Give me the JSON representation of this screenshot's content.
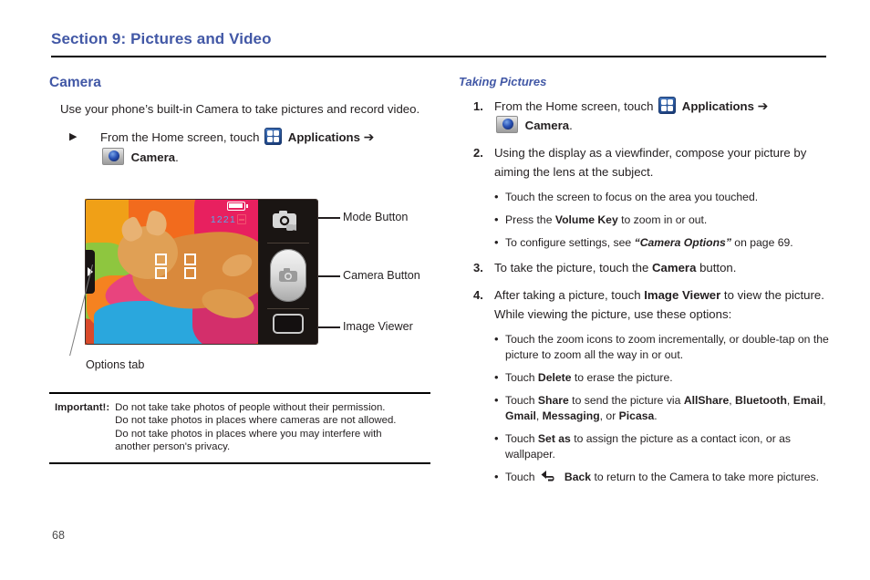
{
  "document": {
    "section_title": "Section 9: Pictures and Video",
    "page_number": "68"
  },
  "left_column": {
    "heading": "Camera",
    "intro": "Use your phone’s built-in Camera to take pictures and record video.",
    "arrow_step": {
      "marker": "▶",
      "text_before": "From the Home screen, touch",
      "apps_label": "Applications",
      "arrow": "➔",
      "camera_label": "Camera",
      "period": "."
    },
    "figure": {
      "status_count": "1221",
      "callouts": [
        {
          "name": "mode-button",
          "label": "Mode Button"
        },
        {
          "name": "camera-button",
          "label": "Camera Button"
        },
        {
          "name": "image-viewer",
          "label": "Image Viewer"
        },
        {
          "name": "options-tab",
          "label": "Options tab"
        }
      ]
    },
    "important_note": {
      "label": "Important!:",
      "lines": [
        "Do not take take photos of people without their permission.",
        "Do not take photos in places where cameras are not allowed.",
        "Do not take photos in places where you may interfere with",
        "another person's privacy."
      ]
    }
  },
  "right_column": {
    "heading": "Taking Pictures",
    "steps": [
      {
        "num": "1.",
        "kind": "icons",
        "text_before": "From the Home screen, touch",
        "apps_label": "Applications",
        "arrow": "➔",
        "camera_label": "Camera",
        "period": "."
      },
      {
        "num": "2.",
        "kind": "plain",
        "text": "Using the display as a viewfinder, compose your picture by aiming the lens at the subject.",
        "bullets": [
          {
            "id": "focus",
            "parts": [
              {
                "t": "Touch the screen to focus on the area you touched.",
                "s": "normal"
              }
            ]
          },
          {
            "id": "volume",
            "parts": [
              {
                "t": "Press the ",
                "s": "normal"
              },
              {
                "t": "Volume Key",
                "s": "bold"
              },
              {
                "t": " to zoom in or out.",
                "s": "normal"
              }
            ]
          },
          {
            "id": "settings",
            "parts": [
              {
                "t": "To configure settings, see ",
                "s": "normal"
              },
              {
                "t": "“Camera Options”",
                "s": "bolditalic"
              },
              {
                "t": " on page 69.",
                "s": "normal"
              }
            ]
          }
        ]
      },
      {
        "num": "3.",
        "kind": "rich",
        "parts": [
          {
            "t": "To take the picture, touch the ",
            "s": "normal"
          },
          {
            "t": "Camera",
            "s": "bold"
          },
          {
            "t": " button.",
            "s": "normal"
          }
        ],
        "bullets": []
      },
      {
        "num": "4.",
        "kind": "rich",
        "parts": [
          {
            "t": "After taking a picture, touch ",
            "s": "normal"
          },
          {
            "t": "Image Viewer",
            "s": "bold"
          },
          {
            "t": " to view the picture. While viewing the picture, use these options:",
            "s": "normal"
          }
        ],
        "bullets": [
          {
            "id": "zoom",
            "parts": [
              {
                "t": "Touch the zoom icons to zoom incrementally, or double-tap on the picture to zoom all the way in or out.",
                "s": "normal"
              }
            ]
          },
          {
            "id": "delete",
            "parts": [
              {
                "t": "Touch ",
                "s": "normal"
              },
              {
                "t": "Delete",
                "s": "bold"
              },
              {
                "t": "  to erase the picture.",
                "s": "normal"
              }
            ]
          },
          {
            "id": "share",
            "parts": [
              {
                "t": "Touch ",
                "s": "normal"
              },
              {
                "t": "Share",
                "s": "bold"
              },
              {
                "t": " to send the picture via ",
                "s": "normal"
              },
              {
                "t": "AllShare",
                "s": "bold"
              },
              {
                "t": ", ",
                "s": "normal"
              },
              {
                "t": "Bluetooth",
                "s": "bold"
              },
              {
                "t": ", ",
                "s": "normal"
              },
              {
                "t": "Email",
                "s": "bold"
              },
              {
                "t": ", ",
                "s": "normal"
              },
              {
                "t": "Gmail",
                "s": "bold"
              },
              {
                "t": ", ",
                "s": "normal"
              },
              {
                "t": "Messaging",
                "s": "bold"
              },
              {
                "t": ", or ",
                "s": "normal"
              },
              {
                "t": "Picasa",
                "s": "bold"
              },
              {
                "t": ".",
                "s": "normal"
              }
            ]
          },
          {
            "id": "setas",
            "parts": [
              {
                "t": "Touch ",
                "s": "normal"
              },
              {
                "t": "Set as",
                "s": "bold"
              },
              {
                "t": "  to assign the picture as a contact icon, or as wallpaper.",
                "s": "normal"
              }
            ]
          },
          {
            "id": "back",
            "icon": "back-arrow-icon",
            "parts": [
              {
                "t": "Touch ",
                "s": "normal"
              },
              {
                "t": "__ICON__",
                "s": "icon"
              },
              {
                "t": "Back",
                "s": "bold"
              },
              {
                "t": "  to return to the Camera to take more pictures.",
                "s": "normal"
              }
            ]
          }
        ]
      }
    ]
  },
  "colors": {
    "heading_blue": "#4258a6",
    "body_black": "#231f20",
    "status_blue": "#5ba8e8",
    "sd_pink": "#f2506e"
  }
}
